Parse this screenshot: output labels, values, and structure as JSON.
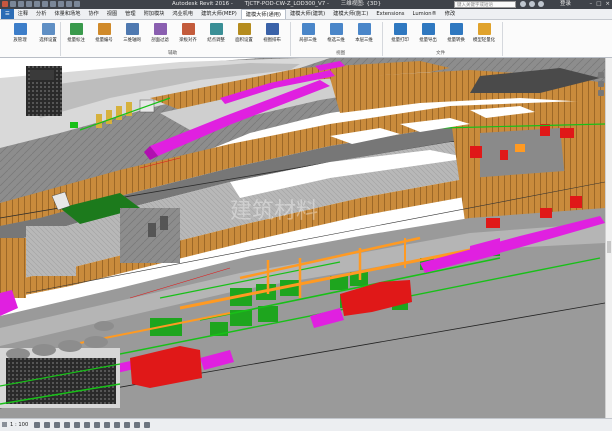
{
  "titlebar": {
    "app_name": "Autodesk Revit 2016 -",
    "doc_name": "TJCTF-POD-CW-Z_LOD300_V7 -",
    "view_name": "三维视图: {3D}",
    "search_placeholder": "键入关键字或短语",
    "login": "登录"
  },
  "tabs": [
    {
      "label": "",
      "app": true
    },
    {
      "label": "注释"
    },
    {
      "label": "分析"
    },
    {
      "label": "体量和场地"
    },
    {
      "label": "协作"
    },
    {
      "label": "视图"
    },
    {
      "label": "管理"
    },
    {
      "label": "附加模块"
    },
    {
      "label": "鸿业机电"
    },
    {
      "label": "建筑大师(MEP)"
    },
    {
      "label": "建模大师(通用)",
      "active": true
    },
    {
      "label": "建模大师(建筑)"
    },
    {
      "label": "建模大师(施工)"
    },
    {
      "label": "Extensions"
    },
    {
      "label": "Lumion®"
    },
    {
      "label": "修改"
    }
  ],
  "ribbon": {
    "buttons": [
      {
        "label": "族管理",
        "color": "#3d7ec9"
      },
      {
        "label": "选择设置",
        "color": "#5f8fc4"
      },
      {
        "label": "批量标注",
        "color": "#3a9a4c"
      },
      {
        "label": "批量编号",
        "color": "#d08a2a"
      },
      {
        "label": "三维轴网",
        "color": "#4f79b0"
      },
      {
        "label": "剖面过滤",
        "color": "#8a5fb0"
      },
      {
        "label": "梁板对齐",
        "color": "#c35b3b"
      },
      {
        "label": "结点调整",
        "color": "#3a8f96"
      },
      {
        "label": "面积设置",
        "color": "#b58c1e"
      },
      {
        "label": "视图排布",
        "color": "#3a62a8"
      },
      {
        "label": "局部三维",
        "color": "#4a86c9"
      },
      {
        "label": "框选三维",
        "color": "#4a86c9"
      },
      {
        "label": "本层三维",
        "color": "#4a86c9"
      },
      {
        "label": "批量打印",
        "color": "#2f78c0"
      },
      {
        "label": "批量导出",
        "color": "#2f78c0"
      },
      {
        "label": "批量转换",
        "color": "#2f78c0"
      },
      {
        "label": "模型轻量化",
        "color": "#e0a22b"
      }
    ],
    "panels": [
      {
        "label": "辅助"
      },
      {
        "label": "视图"
      },
      {
        "label": "文件"
      }
    ]
  },
  "viewport": {
    "watermark": "建筑材料"
  },
  "statusbar": {
    "scale": "1 : 100"
  },
  "colors": {
    "accent": "#2b6cb5",
    "wall_orange": "#c98b3c",
    "duct_magenta": "#e020e0",
    "pipe_green": "#18c018",
    "equipment_red": "#e01818",
    "gray_deck": "#8c8c8c"
  }
}
